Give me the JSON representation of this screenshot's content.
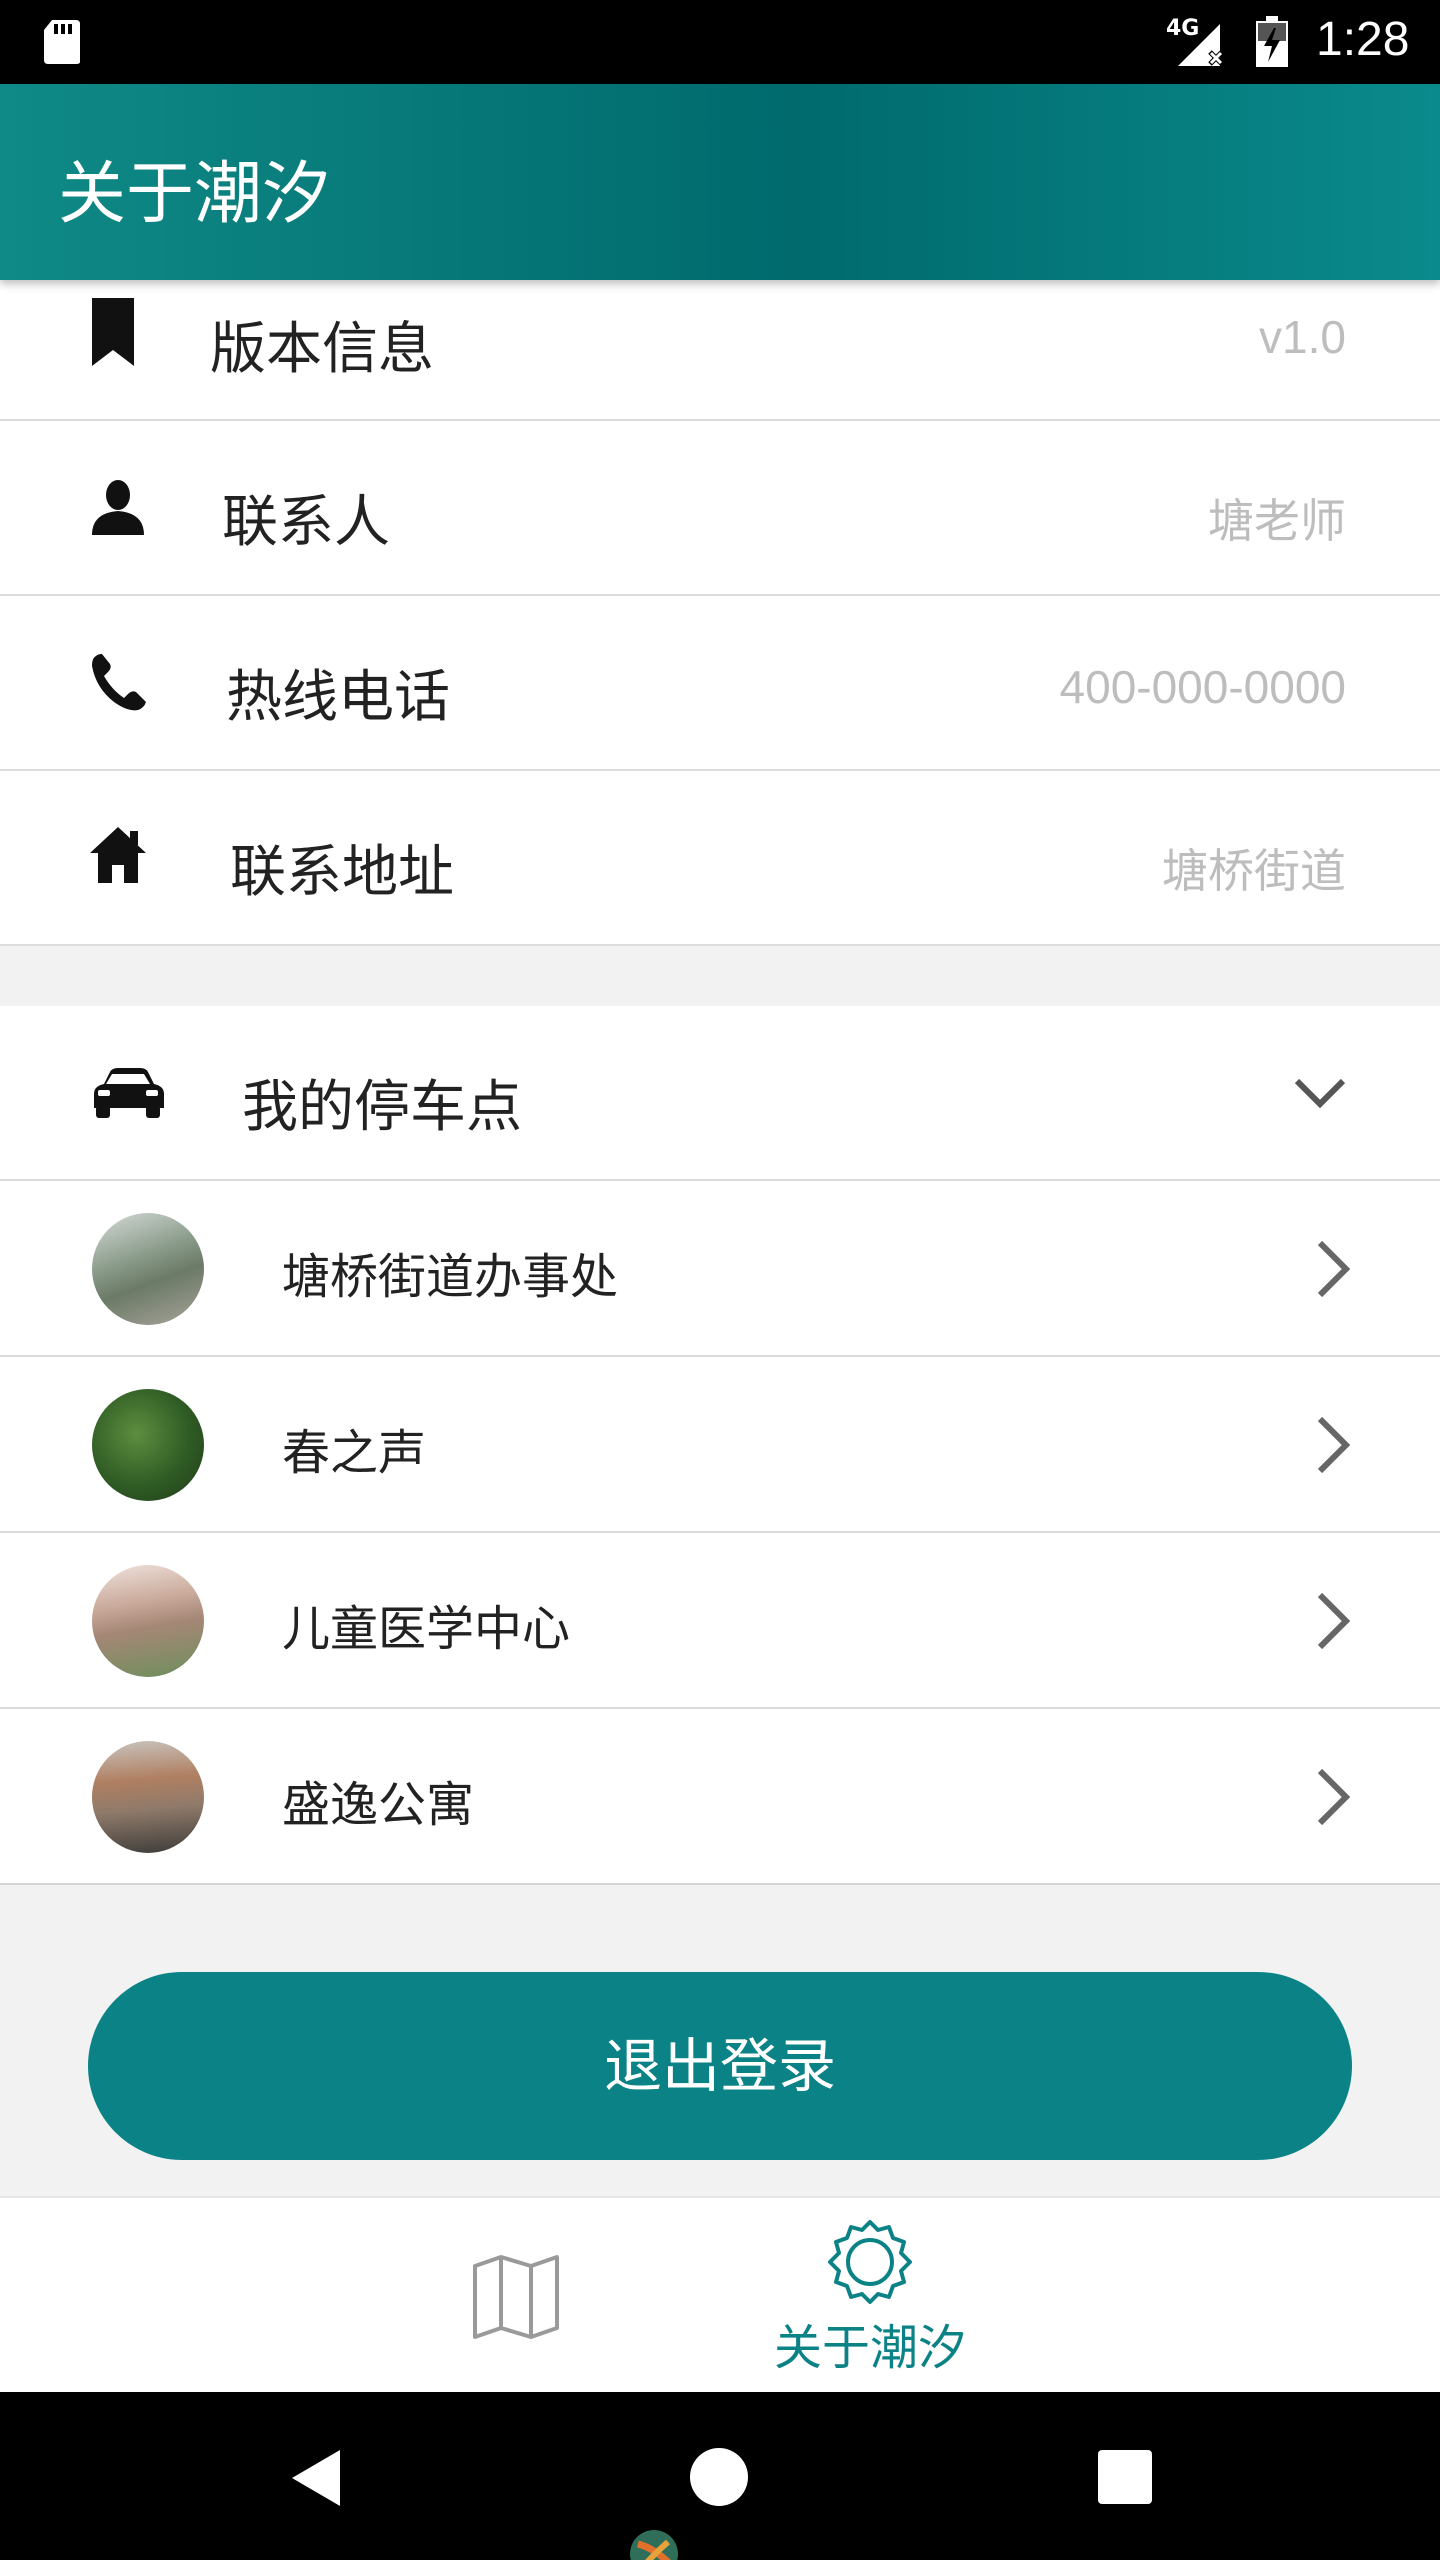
{
  "status_bar": {
    "network": "4G",
    "time": "1:28"
  },
  "app_bar": {
    "title": "关于潮汐"
  },
  "info_rows": [
    {
      "label": "版本信息",
      "value": "v1.0",
      "icon": "bookmark-icon"
    },
    {
      "label": "联系人",
      "value": "塘老师",
      "icon": "person-icon"
    },
    {
      "label": "热线电话",
      "value": "400-000-0000",
      "icon": "phone-icon"
    },
    {
      "label": "联系地址",
      "value": "塘桥街道",
      "icon": "home-icon"
    }
  ],
  "parking": {
    "header": {
      "label": "我的停车点",
      "icon": "car-icon"
    },
    "items": [
      {
        "label": "塘桥街道办事处"
      },
      {
        "label": "春之声"
      },
      {
        "label": "儿童医学中心"
      },
      {
        "label": "盛逸公寓"
      }
    ]
  },
  "logout_label": "退出登录",
  "bottom_nav": {
    "map_icon": "map-icon",
    "about_label": "关于潮汐",
    "about_icon": "gear-icon",
    "accent_color": "#0b8285"
  },
  "colors": {
    "primary": "#0b8285",
    "value_text": "#bdbdbd"
  }
}
